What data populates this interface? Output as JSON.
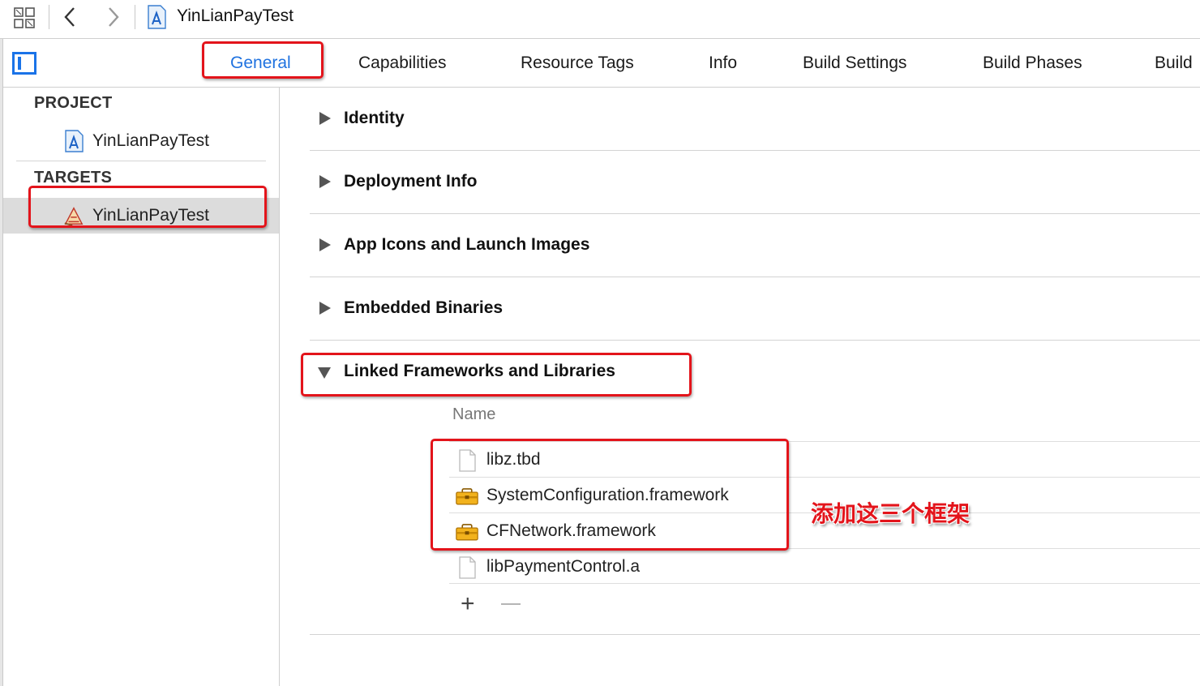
{
  "window": {
    "project_name": "YinLianPayTest"
  },
  "tabs": [
    {
      "label": "General",
      "active": true
    },
    {
      "label": "Capabilities",
      "active": false
    },
    {
      "label": "Resource Tags",
      "active": false
    },
    {
      "label": "Info",
      "active": false
    },
    {
      "label": "Build Settings",
      "active": false
    },
    {
      "label": "Build Phases",
      "active": false
    },
    {
      "label": "Build",
      "active": false
    }
  ],
  "outline": {
    "project_header": "PROJECT",
    "project_item": "YinLianPayTest",
    "targets_header": "TARGETS",
    "target_item": "YinLianPayTest"
  },
  "sections": [
    {
      "title": "Identity",
      "expanded": false
    },
    {
      "title": "Deployment Info",
      "expanded": false
    },
    {
      "title": "App Icons and Launch Images",
      "expanded": false
    },
    {
      "title": "Embedded Binaries",
      "expanded": false
    },
    {
      "title": "Linked Frameworks and Libraries",
      "expanded": true
    }
  ],
  "frameworks": {
    "column_header": "Name",
    "items": [
      {
        "name": "libz.tbd",
        "icon": "document-icon"
      },
      {
        "name": "SystemConfiguration.framework",
        "icon": "toolbox-icon"
      },
      {
        "name": "CFNetwork.framework",
        "icon": "toolbox-icon"
      },
      {
        "name": "libPaymentControl.a",
        "icon": "document-icon"
      }
    ],
    "add_symbol": "+"
  },
  "annotation": {
    "text": "添加这三个框架",
    "color": "#e3141b"
  },
  "colors": {
    "accent": "#1f72e0",
    "selection": "#dcdcdc"
  }
}
